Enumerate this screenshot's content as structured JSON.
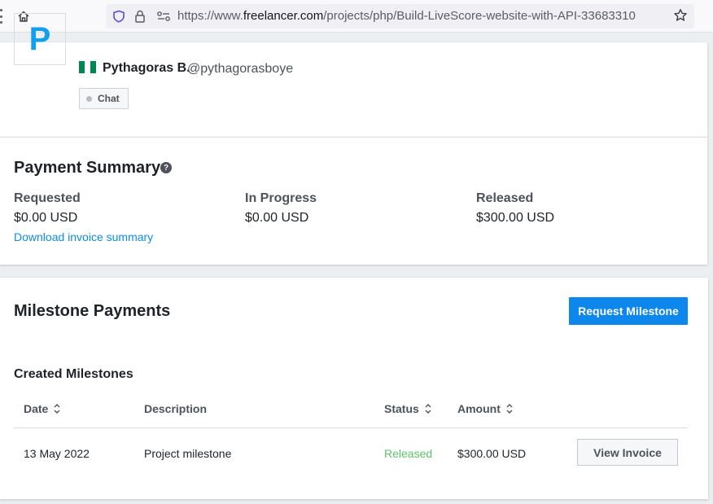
{
  "browser": {
    "url_prefix": "https://www.",
    "url_domain": "freelancer.com",
    "url_path": "/projects/php/Build-LiveScore-website-with-API-33683310"
  },
  "profile": {
    "avatar_letter": "P",
    "name": "Pythagoras B.",
    "handle": "@pythagorasboye",
    "chat_label": "Chat",
    "flag_colors": [
      "#008751",
      "#ffffff",
      "#008751"
    ]
  },
  "payment_summary": {
    "title": "Payment Summary",
    "help_glyph": "?",
    "stats": [
      {
        "label": "Requested",
        "value": "$0.00 USD"
      },
      {
        "label": "In Progress",
        "value": "$0.00 USD"
      },
      {
        "label": "Released",
        "value": "$300.00 USD"
      }
    ],
    "download_link": "Download invoice summary"
  },
  "milestones": {
    "title": "Milestone Payments",
    "request_button": "Request Milestone",
    "created_title": "Created Milestones",
    "columns": [
      "Date",
      "Description",
      "Status",
      "Amount"
    ],
    "rows": [
      {
        "date": "13 May 2022",
        "description": "Project milestone",
        "status": "Released",
        "amount": "$300.00 USD",
        "action": "View Invoice"
      }
    ]
  },
  "colors": {
    "accent": "#0d87eb",
    "link": "#0e8ce4",
    "released": "#5dc26a",
    "avatar": "#139ff0"
  }
}
